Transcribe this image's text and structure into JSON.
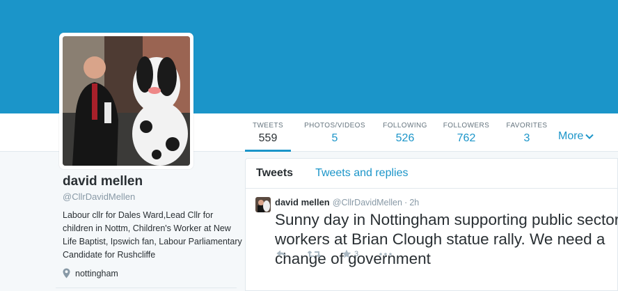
{
  "colors": {
    "brand": "#1b95c9",
    "text": "#292f33",
    "muted": "#8899a6"
  },
  "profile": {
    "name": "david mellen",
    "handle": "@CllrDavidMellen",
    "bio": "Labour cllr for Dales Ward,Lead Cllr for children in Nottm, Children's Worker at New Life Baptist, Ipswich fan, Labour Parliamentary Candidate for Rushcliffe",
    "location": "nottingham",
    "location_icon": "map-pin-icon"
  },
  "stats": [
    {
      "label": "TWEETS",
      "value": "559",
      "active": true
    },
    {
      "label": "PHOTOS/VIDEOS",
      "value": "5",
      "active": false
    },
    {
      "label": "FOLLOWING",
      "value": "526",
      "active": false
    },
    {
      "label": "FOLLOWERS",
      "value": "762",
      "active": false
    },
    {
      "label": "FAVORITES",
      "value": "3",
      "active": false
    }
  ],
  "more_label": "More",
  "timeline_tabs": {
    "tweets": "Tweets",
    "replies": "Tweets and replies"
  },
  "tweet": {
    "name": "david mellen",
    "handle": "@CllrDavidMellen",
    "dot": "·",
    "time": "2h",
    "text": "Sunny day in Nottingham supporting public sector workers at Brian Clough statue rally. We need a change of government",
    "favorite_count": "3",
    "actions": [
      "reply-icon",
      "retweet-icon",
      "favorite-icon",
      "more-options-icon"
    ]
  }
}
